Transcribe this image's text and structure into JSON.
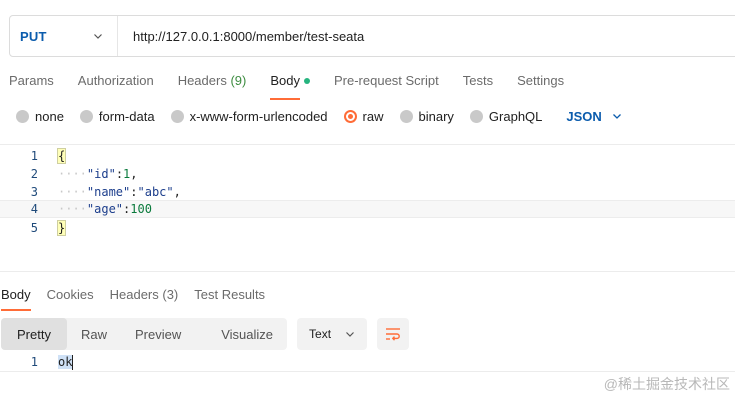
{
  "request": {
    "method": "PUT",
    "url": "http://127.0.0.1:8000/member/test-seata"
  },
  "request_tabs": [
    {
      "label": "Params"
    },
    {
      "label": "Authorization"
    },
    {
      "label": "Headers",
      "count": "(9)"
    },
    {
      "label": "Body"
    },
    {
      "label": "Pre-request Script"
    },
    {
      "label": "Tests"
    },
    {
      "label": "Settings"
    }
  ],
  "body_types": {
    "options": [
      "none",
      "form-data",
      "x-www-form-urlencoded",
      "raw",
      "binary",
      "GraphQL"
    ],
    "selected": "raw",
    "language": "JSON"
  },
  "editor": {
    "line_numbers": [
      "1",
      "2",
      "3",
      "4",
      "5"
    ],
    "lines": {
      "l1": "{",
      "l2_key": "\"id\"",
      "l2_colon": ":",
      "l2_val": "1",
      "l2_comma": ",",
      "l3_key": "\"name\"",
      "l3_colon": ":",
      "l3_val": "\"abc\"",
      "l3_comma": ",",
      "l4_key": "\"age\"",
      "l4_colon": ":",
      "l4_val": "100",
      "l5": "}"
    }
  },
  "response_tabs": [
    {
      "label": "Body"
    },
    {
      "label": "Cookies"
    },
    {
      "label": "Headers (3)"
    },
    {
      "label": "Test Results"
    }
  ],
  "response_view": {
    "modes": [
      "Pretty",
      "Raw",
      "Preview",
      "Visualize"
    ],
    "active_mode": "Pretty",
    "format": "Text"
  },
  "response_body": {
    "line_number": "1",
    "text": "ok"
  },
  "watermark": "@稀土掘金技术社区",
  "colors": {
    "accent": "#ff6c37",
    "method_blue": "#0b5cad",
    "status_green": "#26b47f"
  }
}
